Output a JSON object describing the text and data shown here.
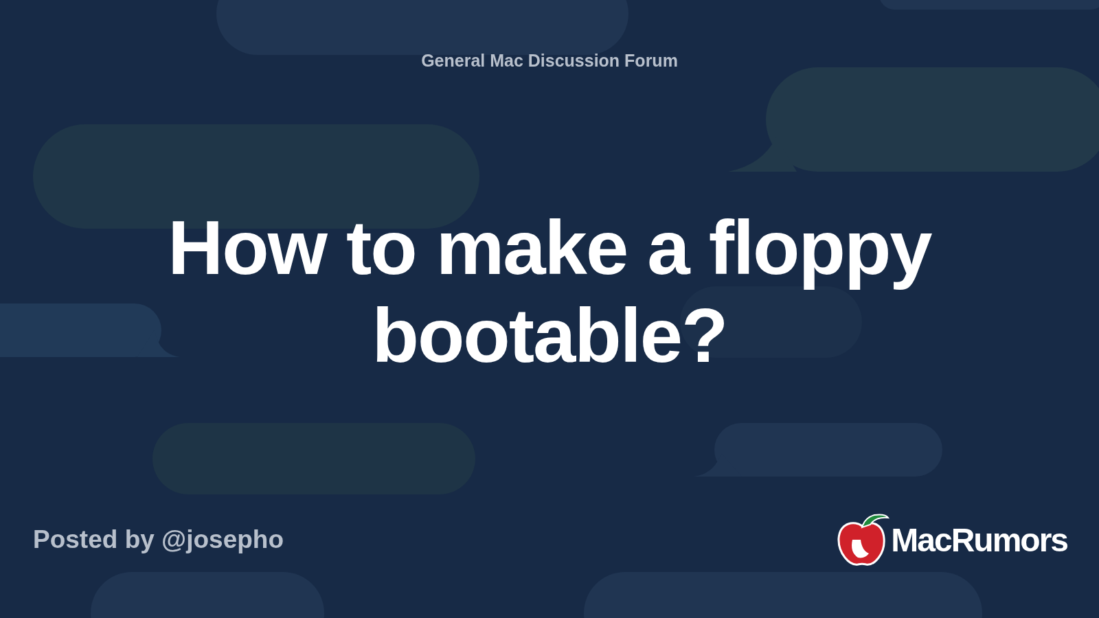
{
  "forum": "General Mac Discussion Forum",
  "title": "How to make a floppy bootable?",
  "posted_by": "Posted by @josepho",
  "logo": {
    "text": "MacRumors"
  }
}
